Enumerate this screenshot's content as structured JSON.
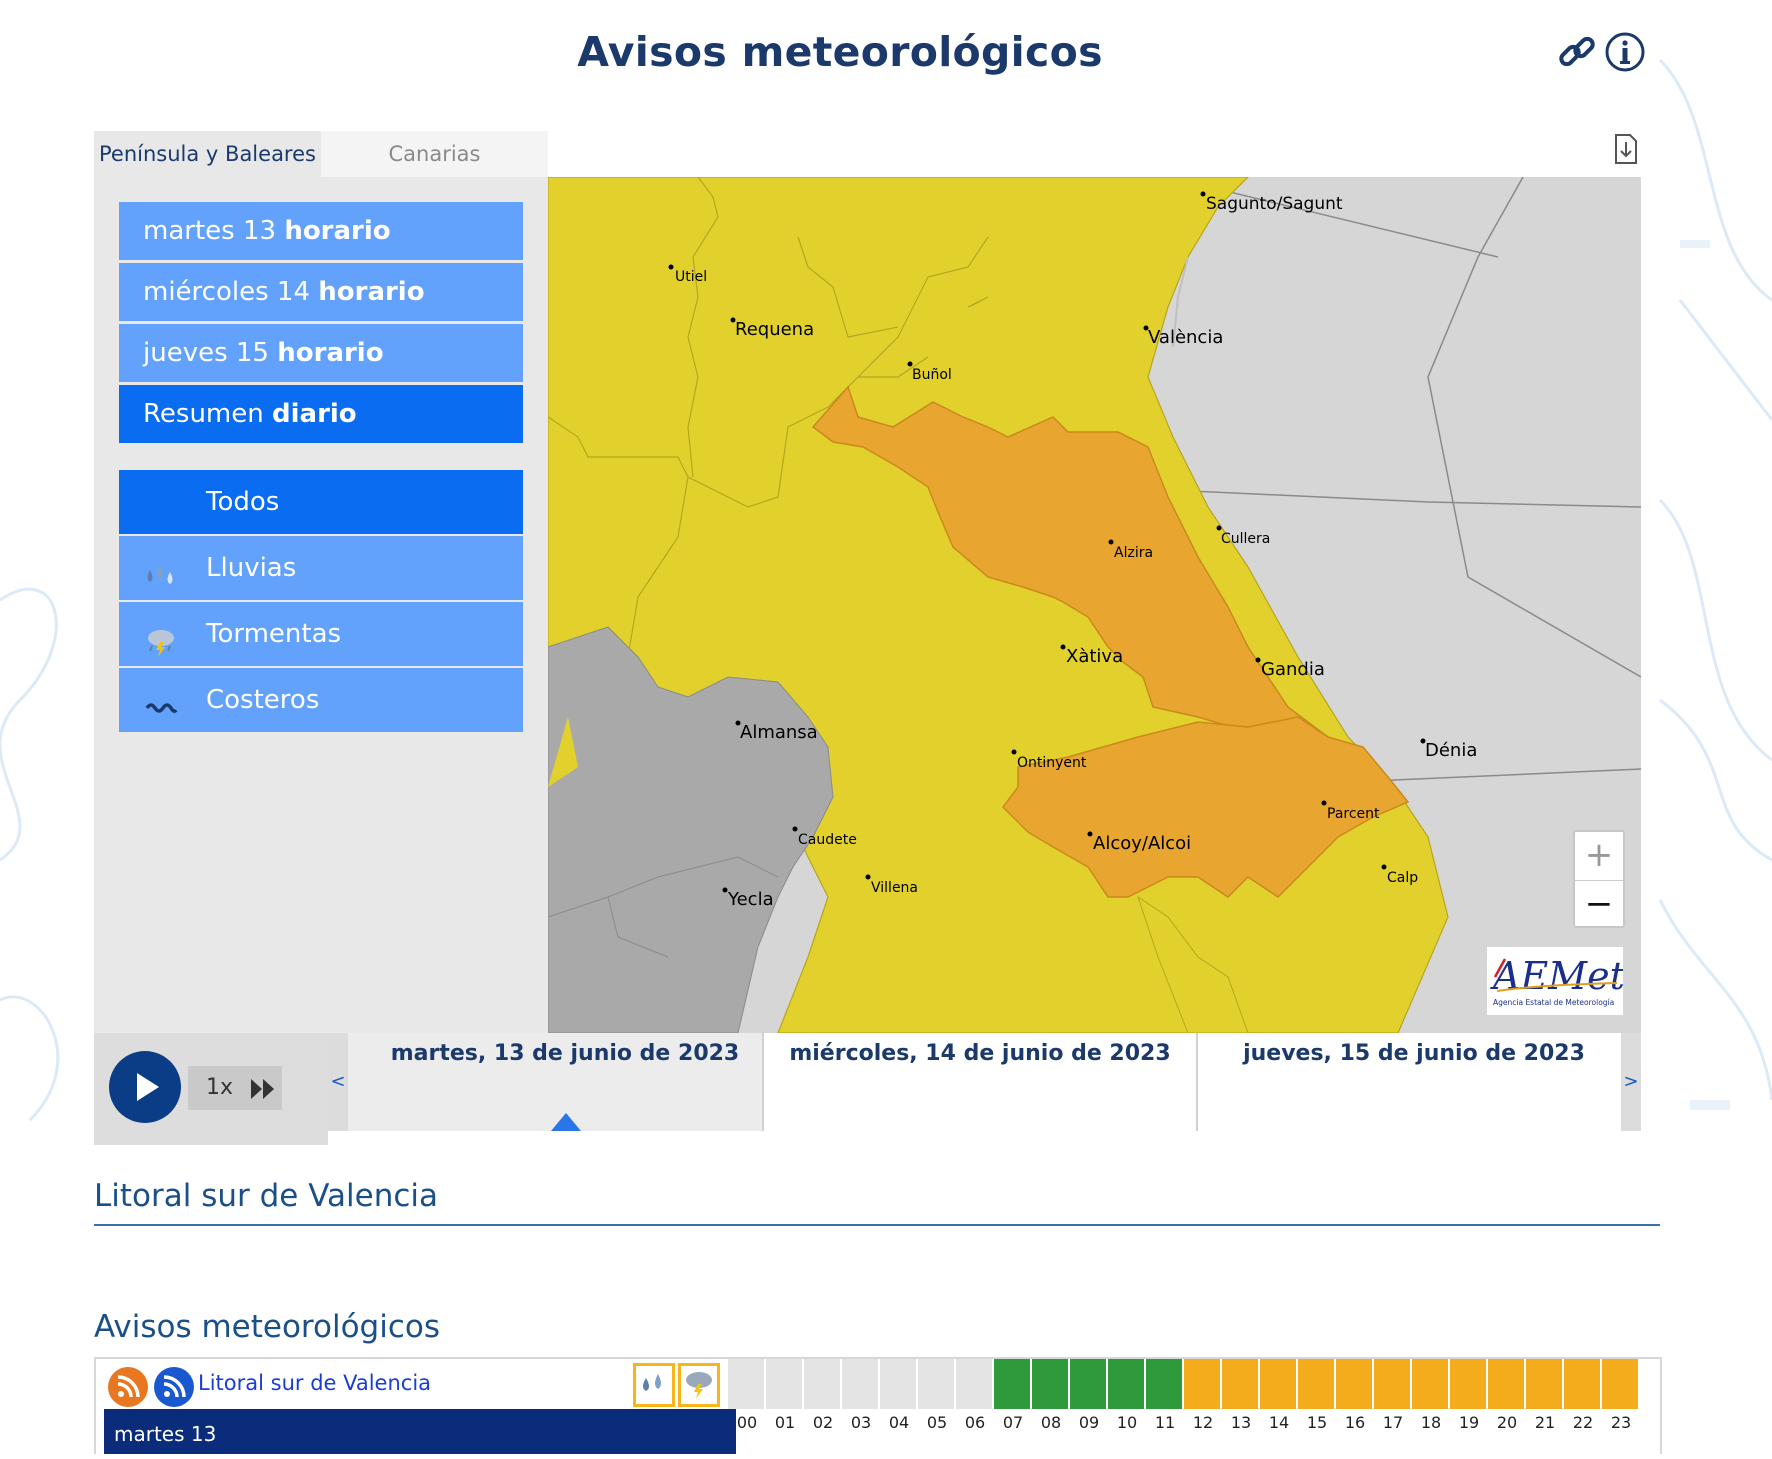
{
  "header": {
    "title": "Avisos meteorológicos",
    "link_icon": "link-icon",
    "info_icon": "info-icon"
  },
  "tabs": [
    {
      "label": "Península y Baleares",
      "active": true
    },
    {
      "label": "Canarias",
      "active": false
    }
  ],
  "download_icon": "download-icon",
  "days": [
    {
      "day": "martes 13",
      "suffix": "horario"
    },
    {
      "day": "miércoles 14",
      "suffix": "horario"
    },
    {
      "day": "jueves 15",
      "suffix": "horario"
    },
    {
      "day": "Resumen",
      "suffix": "diario",
      "selected": true
    }
  ],
  "filters": [
    {
      "label": "Todos",
      "icon": "",
      "selected": true
    },
    {
      "label": "Lluvias",
      "icon": "rain-icon"
    },
    {
      "label": "Tormentas",
      "icon": "storm-icon"
    },
    {
      "label": "Costeros",
      "icon": "coastal-icon"
    }
  ],
  "map": {
    "cities": [
      "Sagunto/Sagunt",
      "Utiel",
      "Requena",
      "València",
      "Buñol",
      "Alzira",
      "Cullera",
      "Xàtiva",
      "Gandia",
      "Almansa",
      "Dénia",
      "Ontinyent",
      "Parcent",
      "Caudete",
      "Alcoy/Alcoi",
      "Villena",
      "Calp",
      "Yecla"
    ],
    "colors": {
      "yellow": "#e2d12c",
      "orange": "#e8a631",
      "grey_land": "#a9a9a9",
      "sea": "#d6d6d6"
    },
    "zoom_in": "+",
    "zoom_out": "−",
    "logo_text": "AEMet",
    "logo_sub": "Agencia Estatal de Meteorología"
  },
  "player": {
    "speed": "1x",
    "play_icon": "play-icon",
    "forward_icon": "fast-forward-icon"
  },
  "timeline": {
    "prev": "<",
    "next": ">",
    "days": [
      "martes, 13 de junio de 2023",
      "miércoles, 14 de junio de 2023",
      "jueves, 15 de junio de 2023"
    ]
  },
  "zone_title": "Litoral sur de Valencia",
  "warnings_title": "Avisos meteorológicos",
  "warn_table": {
    "zone_link": "Litoral sur de Valencia",
    "date_label": "martes 13",
    "hours": [
      "00",
      "01",
      "02",
      "03",
      "04",
      "05",
      "06",
      "07",
      "08",
      "09",
      "10",
      "11",
      "12",
      "13",
      "14",
      "15",
      "16",
      "17",
      "18",
      "19",
      "20",
      "21",
      "22",
      "23"
    ],
    "hour_levels": [
      "none",
      "none",
      "none",
      "none",
      "none",
      "none",
      "none",
      "green",
      "green",
      "green",
      "green",
      "green",
      "yellow",
      "yellow",
      "yellow",
      "yellow",
      "yellow",
      "yellow",
      "yellow",
      "yellow",
      "yellow",
      "yellow",
      "yellow",
      "yellow"
    ],
    "level_colors": {
      "none": "#e4e4e4",
      "green": "#2f9a3b",
      "yellow": "#f5ac1c"
    },
    "icons": [
      "rain-icon",
      "storm-icon"
    ]
  }
}
